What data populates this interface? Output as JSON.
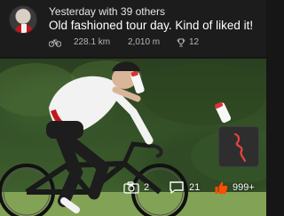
{
  "activity": {
    "meta": "Yesterday with 39 others",
    "title": "Old fashioned tour day. Kind of liked it!",
    "stats": {
      "distance": "228.1 km",
      "elevation": "2,010 m",
      "achievements": "12"
    }
  },
  "overlay": {
    "photos_count": "2",
    "comments_count": "21",
    "kudos_count": "999+"
  },
  "colors": {
    "accent": "#fc4c02",
    "route": "#e8453c"
  }
}
